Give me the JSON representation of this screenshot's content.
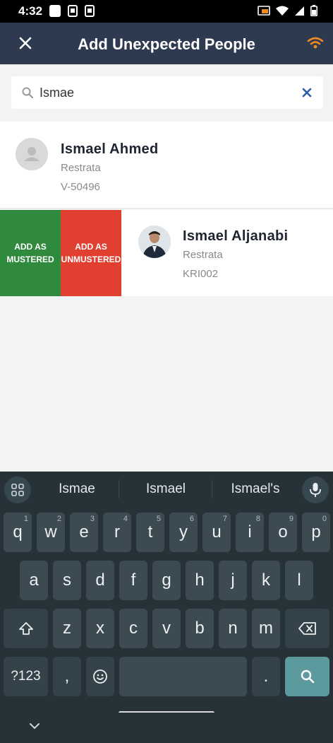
{
  "status_bar": {
    "time": "4:32"
  },
  "app_bar": {
    "title": "Add Unexpected People",
    "accent_color": "#f08a24"
  },
  "search": {
    "value": "Ismae",
    "placeholder": ""
  },
  "people": [
    {
      "name": "Ismael Ahmed",
      "company": "Restrata",
      "id": "V-50496",
      "avatar": "person-placeholder-icon"
    },
    {
      "name": "Ismael Aljanabi",
      "company": "Restrata",
      "id": "KRI002",
      "avatar": "profile-photo"
    }
  ],
  "swipe_actions": {
    "mustered_line1": "ADD AS",
    "mustered_line2": "MUSTERED",
    "unmustered_line1": "ADD AS",
    "unmustered_line2": "UNMUSTERED",
    "mustered_color": "#2f8a3e",
    "unmustered_color": "#e13f30"
  },
  "keyboard": {
    "suggestions": [
      "Ismae",
      "Ismael",
      "Ismael's"
    ],
    "row1": [
      {
        "key": "q",
        "hint": "1"
      },
      {
        "key": "w",
        "hint": "2"
      },
      {
        "key": "e",
        "hint": "3"
      },
      {
        "key": "r",
        "hint": "4"
      },
      {
        "key": "t",
        "hint": "5"
      },
      {
        "key": "y",
        "hint": "6"
      },
      {
        "key": "u",
        "hint": "7"
      },
      {
        "key": "i",
        "hint": "8"
      },
      {
        "key": "o",
        "hint": "9"
      },
      {
        "key": "p",
        "hint": "0"
      }
    ],
    "row2": [
      "a",
      "s",
      "d",
      "f",
      "g",
      "h",
      "j",
      "k",
      "l"
    ],
    "row3": [
      "z",
      "x",
      "c",
      "v",
      "b",
      "n",
      "m"
    ],
    "symbols_key": "?123",
    "comma_key": ",",
    "period_key": "."
  }
}
